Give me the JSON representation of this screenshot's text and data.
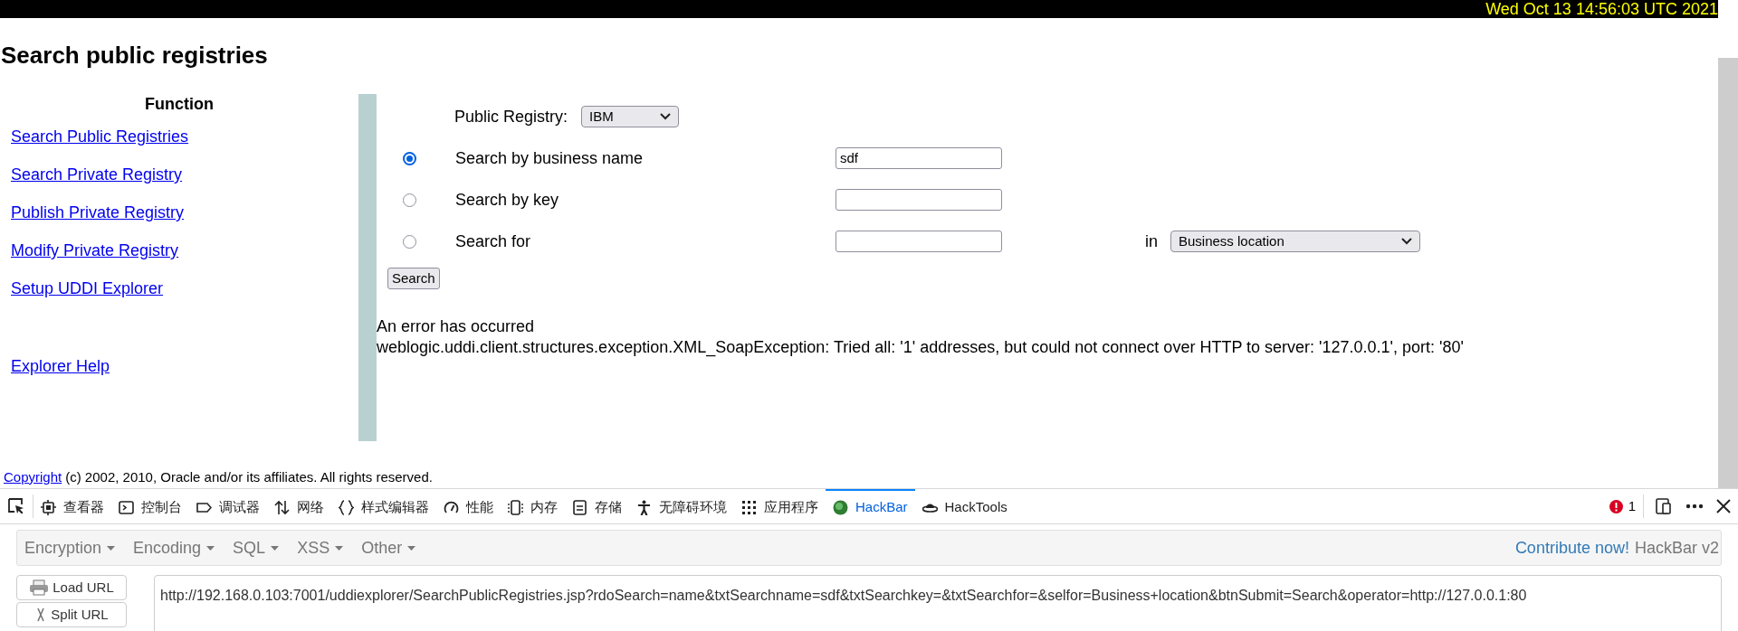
{
  "clock": "Wed Oct 13 14:56:03 UTC 2021",
  "page_title": "Search public registries",
  "sidebar": {
    "heading": "Function",
    "links": [
      "Search Public Registries",
      "Search Private Registry",
      "Publish Private Registry",
      "Modify Private Registry",
      "Setup UDDI Explorer"
    ],
    "help_link": "Explorer Help"
  },
  "form": {
    "registry_label": "Public Registry:",
    "registry_value": "IBM",
    "options": [
      {
        "label": "Search by business name",
        "selected": true,
        "value": "sdf"
      },
      {
        "label": "Search by key",
        "selected": false
      },
      {
        "label": "Search for",
        "selected": false,
        "in_label": "in",
        "in_value": "Business location"
      }
    ],
    "search_button": "Search"
  },
  "error": {
    "title": "An error has occurred",
    "message": "weblogic.uddi.client.structures.exception.XML_SoapException: Tried all: '1' addresses, but could not connect over HTTP to server: '127.0.0.1', port: '80'"
  },
  "footer": {
    "link": "Copyright",
    "text": "(c) 2002, 2010, Oracle and/or its affiliates. All rights reserved."
  },
  "devtools": {
    "tabs": [
      {
        "label": "查看器",
        "selected": false
      },
      {
        "label": "控制台",
        "selected": false
      },
      {
        "label": "调试器",
        "selected": false
      },
      {
        "label": "网络",
        "selected": false
      },
      {
        "label": "样式编辑器",
        "selected": false
      },
      {
        "label": "性能",
        "selected": false
      },
      {
        "label": "内存",
        "selected": false
      },
      {
        "label": "存储",
        "selected": false
      },
      {
        "label": "无障碍环境",
        "selected": false
      },
      {
        "label": "应用程序",
        "selected": false
      },
      {
        "label": "HackBar",
        "selected": true
      },
      {
        "label": "HackTools",
        "selected": false
      }
    ],
    "error_count": "1"
  },
  "hackbar": {
    "menus": [
      "Encryption",
      "Encoding",
      "SQL",
      "XSS",
      "Other"
    ],
    "contribute": "Contribute now!",
    "version": "HackBar v2",
    "buttons": [
      "Load URL",
      "Split URL"
    ],
    "url": "http://192.168.0.103:7001/uddiexplorer/SearchPublicRegistries.jsp?rdoSearch=name&txtSearchname=sdf&txtSearchkey=&txtSearchfor=&selfor=Business+location&btnSubmit=Search&operator=http://127.0.0.1:80"
  }
}
